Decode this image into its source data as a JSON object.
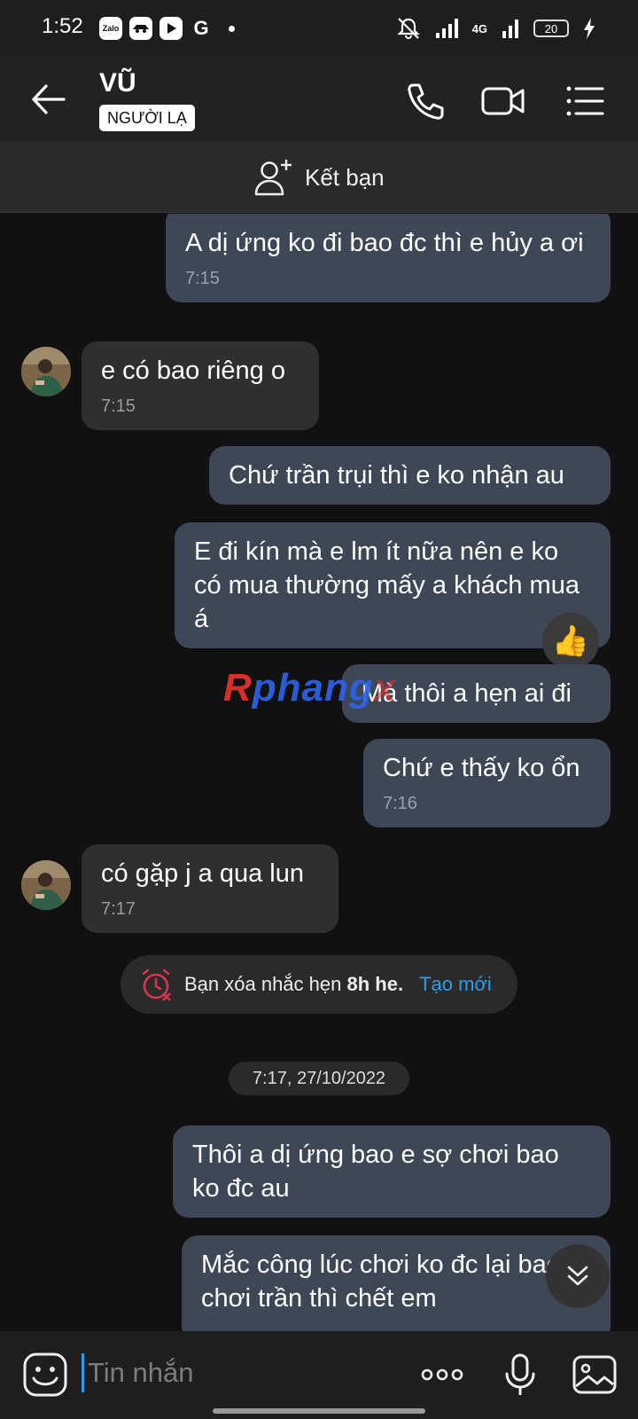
{
  "status_bar": {
    "time": "1:52",
    "app_icons": [
      "Zalo",
      "spy-icon",
      "youtube-icon",
      "google-icon"
    ],
    "battery": "20",
    "network": "4G"
  },
  "header": {
    "contact_name": "VŨ",
    "badge": "NGƯỜI LẠ"
  },
  "add_friend": {
    "label": "Kết bạn"
  },
  "messages": [
    {
      "side": "out",
      "text": "A dị ứng ko đi bao đc thì e hủy a ơi",
      "time": "7:15"
    },
    {
      "side": "in",
      "text": "e có bao riêng o",
      "time": "7:15"
    },
    {
      "side": "out",
      "text": "Chứ trần trụi thì e ko nhận au",
      "time": ""
    },
    {
      "side": "out",
      "text": "E đi kín mà e lm ít nữa nên e ko có mua thường mấy a khách mua á",
      "time": ""
    },
    {
      "side": "out",
      "text": "Mà thôi a hẹn ai đi",
      "time": ""
    },
    {
      "side": "out",
      "text": "Chứ e thấy ko ổn",
      "time": "7:16"
    },
    {
      "side": "in",
      "text": "có gặp j a qua lun",
      "time": "7:17"
    },
    {
      "side": "out",
      "text": "Thôi a dị ứng bao e sợ chơi bao ko đc au",
      "time": ""
    },
    {
      "side": "out",
      "text": "Mắc công lúc chơi ko đc lại bao chơi trần thì chết em",
      "time": ""
    }
  ],
  "reaction": "👍",
  "watermark": {
    "r": "R",
    "main": "phang",
    "x": "x"
  },
  "system_notice": {
    "prefix": "Bạn xóa nhắc hẹn",
    "bold": "8h he.",
    "link": "Tạo mới"
  },
  "date_divider": "7:17, 27/10/2022",
  "composer": {
    "placeholder": "Tin nhắn"
  },
  "colors": {
    "outgoing_bubble": "#3d4756",
    "incoming_bubble": "#2f2f2f",
    "link": "#2d9cf0",
    "background": "#111111"
  }
}
